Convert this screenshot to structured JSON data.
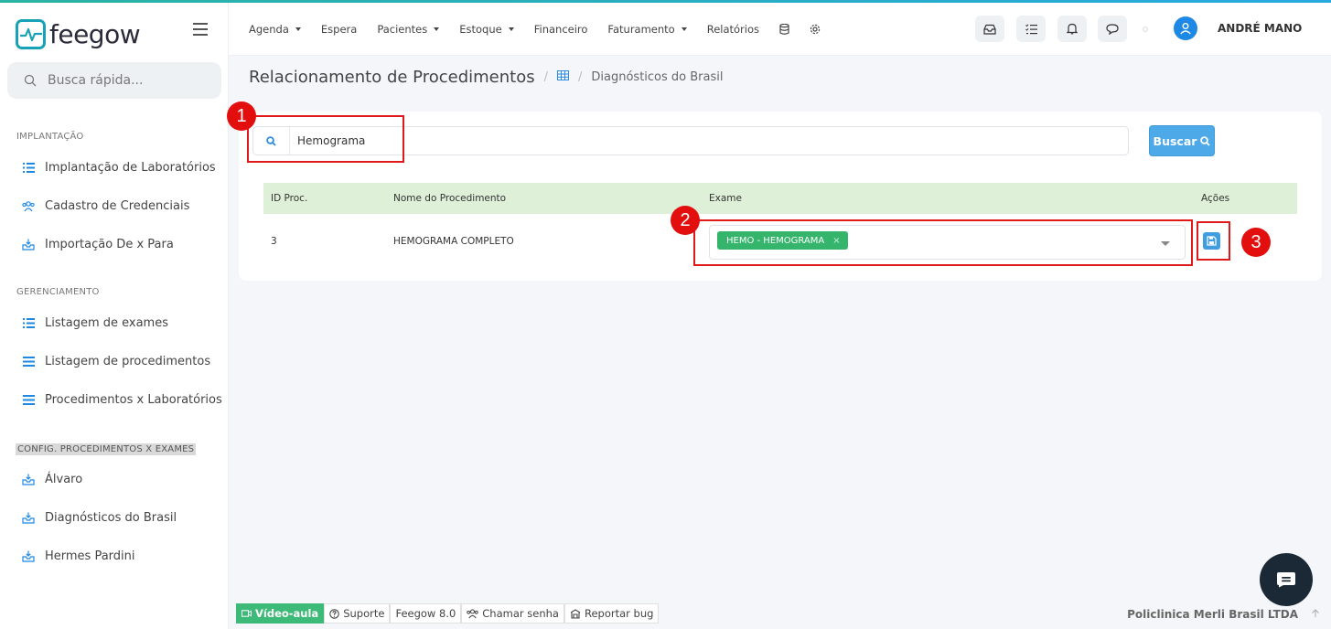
{
  "app": {
    "brand": "feegow",
    "user_name": "ANDRÉ MANO",
    "accent": "#4da9e8",
    "success": "#35b46c",
    "annotation": "#e01a1a"
  },
  "sidebar": {
    "search_placeholder": "Busca rápida...",
    "sections": [
      {
        "title": "IMPLANTAÇÃO",
        "items": [
          {
            "label": "Implantação de Laboratórios",
            "icon": "list-icon"
          },
          {
            "label": "Cadastro de Credenciais",
            "icon": "users-icon"
          },
          {
            "label": "Importação De x Para",
            "icon": "inbox-icon"
          }
        ]
      },
      {
        "title": "GERENCIAMENTO",
        "items": [
          {
            "label": "Listagem de exames",
            "icon": "list-icon"
          },
          {
            "label": "Listagem de procedimentos",
            "icon": "bars-icon"
          },
          {
            "label": "Procedimentos x Laboratórios",
            "icon": "bars-icon"
          }
        ]
      },
      {
        "title": "CONFIG. PROCEDIMENTOS X EXAMES",
        "items": [
          {
            "label": "Álvaro",
            "icon": "inbox-icon"
          },
          {
            "label": "Diagnósticos do Brasil",
            "icon": "inbox-icon"
          },
          {
            "label": "Hermes Pardini",
            "icon": "inbox-icon"
          }
        ]
      }
    ]
  },
  "topnav": {
    "menu": [
      {
        "label": "Agenda",
        "dropdown": true
      },
      {
        "label": "Espera",
        "dropdown": false
      },
      {
        "label": "Pacientes",
        "dropdown": true
      },
      {
        "label": "Estoque",
        "dropdown": true
      },
      {
        "label": "Financeiro",
        "dropdown": false
      },
      {
        "label": "Faturamento",
        "dropdown": true
      },
      {
        "label": "Relatórios",
        "dropdown": false
      }
    ]
  },
  "breadcrumb": {
    "title": "Relacionamento de Procedimentos",
    "separator": "/",
    "current": "Diagnósticos do Brasil"
  },
  "search": {
    "value": "Hemograma",
    "button_label": "Buscar"
  },
  "table": {
    "headers": [
      "ID Proc.",
      "Nome do Procedimento",
      "Exame",
      "Ações"
    ],
    "rows": [
      {
        "id": "3",
        "name": "HEMOGRAMA COMPLETO",
        "exam_tag": "HEMO - HEMOGRAMA",
        "tag_remove": "×"
      }
    ]
  },
  "annotations": [
    "1",
    "2",
    "3"
  ],
  "footer": {
    "video_label": "Vídeo-aula",
    "support_label": "Suporte",
    "version_label": "Feegow 8.0",
    "call_label": "Chamar senha",
    "bug_label": "Reportar bug",
    "company": "Policlinica Merli Brasil LTDA"
  }
}
